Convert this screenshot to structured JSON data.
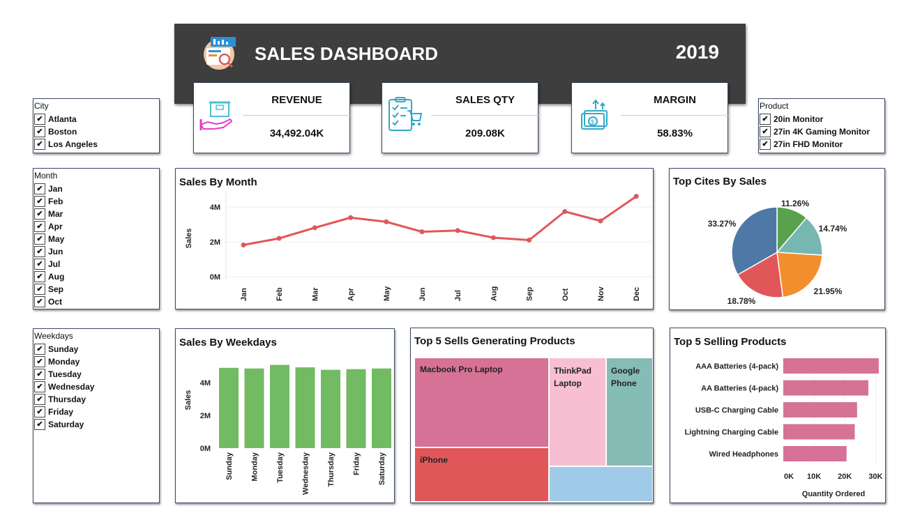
{
  "header": {
    "title": "SALES DASHBOARD",
    "year": "2019"
  },
  "kpis": [
    {
      "label": "REVENUE",
      "value": "34,492.04K",
      "icon": "revenue-box-hand-icon"
    },
    {
      "label": "SALES QTY",
      "value": "209.08K",
      "icon": "checklist-cart-icon"
    },
    {
      "label": "MARGIN",
      "value": "58.83%",
      "icon": "money-growth-icon"
    }
  ],
  "filters": {
    "city": {
      "label": "City",
      "items": [
        "Atlanta",
        "Boston",
        "Los Angeles"
      ]
    },
    "product": {
      "label": "Product",
      "items": [
        "20in Monitor",
        "27in 4K Gaming Monitor",
        "27in FHD Monitor"
      ]
    },
    "month": {
      "label": "Month",
      "items": [
        "Jan",
        "Feb",
        "Mar",
        "Apr",
        "May",
        "Jun",
        "Jul",
        "Aug",
        "Sep",
        "Oct"
      ]
    },
    "weekdays": {
      "label": "Weekdays",
      "items": [
        "Sunday",
        "Monday",
        "Tuesday",
        "Wednesday",
        "Thursday",
        "Friday",
        "Saturday"
      ]
    }
  },
  "colors": {
    "banner": "#3e3e3f",
    "line": "#e05759",
    "bars_green": "#72bb62",
    "bars_pink": "#d57295",
    "panel_border": "#3b4a66"
  },
  "chart_data": [
    {
      "id": "sales-by-month",
      "type": "line",
      "title": "Sales By Month",
      "xlabel": "",
      "ylabel": "Sales",
      "categories": [
        "Jan",
        "Feb",
        "Mar",
        "Apr",
        "May",
        "Jun",
        "Jul",
        "Aug",
        "Sep",
        "Oct",
        "Nov",
        "Dec"
      ],
      "values": [
        1.82,
        2.2,
        2.81,
        3.39,
        3.15,
        2.58,
        2.65,
        2.24,
        2.1,
        3.74,
        3.2,
        4.61
      ],
      "unit": "M",
      "ylim": [
        0,
        5
      ],
      "yticks": [
        "0M",
        "2M",
        "4M"
      ],
      "grid": true
    },
    {
      "id": "top-cities",
      "type": "pie",
      "title": "Top Cites By Sales",
      "slices": [
        {
          "label": "11.26%",
          "value": 11.26,
          "color": "#59a14f"
        },
        {
          "label": "14.74%",
          "value": 14.74,
          "color": "#76b7b2"
        },
        {
          "label": "21.95%",
          "value": 21.95,
          "color": "#f28e2b"
        },
        {
          "label": "18.78%",
          "value": 18.78,
          "color": "#e15759"
        },
        {
          "label": "33.27%",
          "value": 33.27,
          "color": "#4e79a7"
        }
      ]
    },
    {
      "id": "sales-by-weekdays",
      "type": "bar",
      "title": "Sales By Weekdays",
      "xlabel": "",
      "ylabel": "Sales",
      "categories": [
        "Sunday",
        "Monday",
        "Tuesday",
        "Wednesday",
        "Thursday",
        "Friday",
        "Saturday"
      ],
      "values": [
        4.9,
        4.86,
        5.08,
        4.93,
        4.78,
        4.82,
        4.86
      ],
      "unit": "M",
      "ylim": [
        0,
        5.4
      ],
      "yticks": [
        "0M",
        "2M",
        "4M"
      ]
    },
    {
      "id": "top-sells-products",
      "type": "treemap",
      "title": "Top 5 Sells Generating Products",
      "items": [
        {
          "label": "Macbook Pro Laptop",
          "color": "#d57295"
        },
        {
          "label": "iPhone",
          "color": "#e15759"
        },
        {
          "label": "ThinkPad Laptop",
          "color": "#f8bfd3"
        },
        {
          "label": "Google Phone",
          "color": "#85bcb5"
        },
        {
          "label": "",
          "color": "#a0cbe8"
        }
      ]
    },
    {
      "id": "top-selling-products",
      "type": "bar",
      "orientation": "horizontal",
      "title": "Top 5 Selling Products",
      "xlabel": "Quantity Ordered",
      "ylabel": "",
      "categories": [
        "AAA Batteries (4-pack)",
        "AA Batteries (4-pack)",
        "USB-C Charging Cable",
        "Lightning Charging Cable",
        "Wired Headphones"
      ],
      "values": [
        31017,
        27635,
        23975,
        23217,
        20557
      ],
      "xlim": [
        0,
        31500
      ],
      "xticks": [
        "0K",
        "10K",
        "20K",
        "30K"
      ]
    }
  ]
}
